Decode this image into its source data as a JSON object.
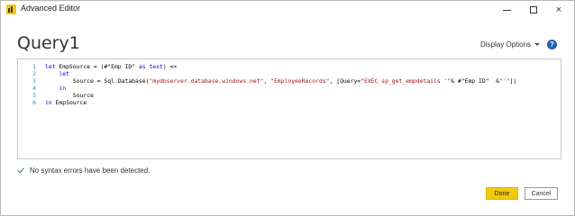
{
  "window": {
    "title": "Advanced Editor",
    "controls": {
      "minimize": "minimize",
      "maximize": "maximize",
      "close": "×"
    }
  },
  "query": {
    "name": "Query1"
  },
  "toolbar": {
    "display_options_label": "Display Options",
    "help_label": "?"
  },
  "editor": {
    "lines": [
      {
        "num": "1",
        "tokens": [
          {
            "t": "let",
            "c": "kw"
          },
          {
            "t": " EmpSource = (#\"Emp ID\" ",
            "c": ""
          },
          {
            "t": "as",
            "c": "kw"
          },
          {
            "t": " ",
            "c": ""
          },
          {
            "t": "text",
            "c": "kw"
          },
          {
            "t": ") =>",
            "c": ""
          }
        ]
      },
      {
        "num": "2",
        "tokens": [
          {
            "t": "    ",
            "c": ""
          },
          {
            "t": "let",
            "c": "kw"
          }
        ]
      },
      {
        "num": "3",
        "tokens": [
          {
            "t": "        Source = Sql.Database(",
            "c": ""
          },
          {
            "t": "\"mydbserver.database.windows.net\"",
            "c": "str"
          },
          {
            "t": ", ",
            "c": ""
          },
          {
            "t": "\"EmployeeRecords\"",
            "c": "str"
          },
          {
            "t": ", [Query=",
            "c": ""
          },
          {
            "t": "\"EXEC sp_get_empdetails '\"",
            "c": "str"
          },
          {
            "t": "& #\"Emp ID\"  &",
            "c": ""
          },
          {
            "t": "\"'\"",
            "c": "str"
          },
          {
            "t": "])",
            "c": ""
          }
        ]
      },
      {
        "num": "4",
        "tokens": [
          {
            "t": "    ",
            "c": ""
          },
          {
            "t": "in",
            "c": "kw"
          }
        ]
      },
      {
        "num": "5",
        "tokens": [
          {
            "t": "        Source",
            "c": ""
          }
        ]
      },
      {
        "num": "6",
        "tokens": [
          {
            "t": "in",
            "c": "kw"
          },
          {
            "t": " EmpSource",
            "c": ""
          }
        ]
      }
    ]
  },
  "status": {
    "message": "No syntax errors have been detected."
  },
  "footer": {
    "done_label": "Done",
    "cancel_label": "Cancel"
  },
  "colors": {
    "accent": "#f2c811",
    "keyword": "#0000ff",
    "string": "#a31515",
    "line_number": "#2b91af",
    "ok": "#2e7d32"
  }
}
